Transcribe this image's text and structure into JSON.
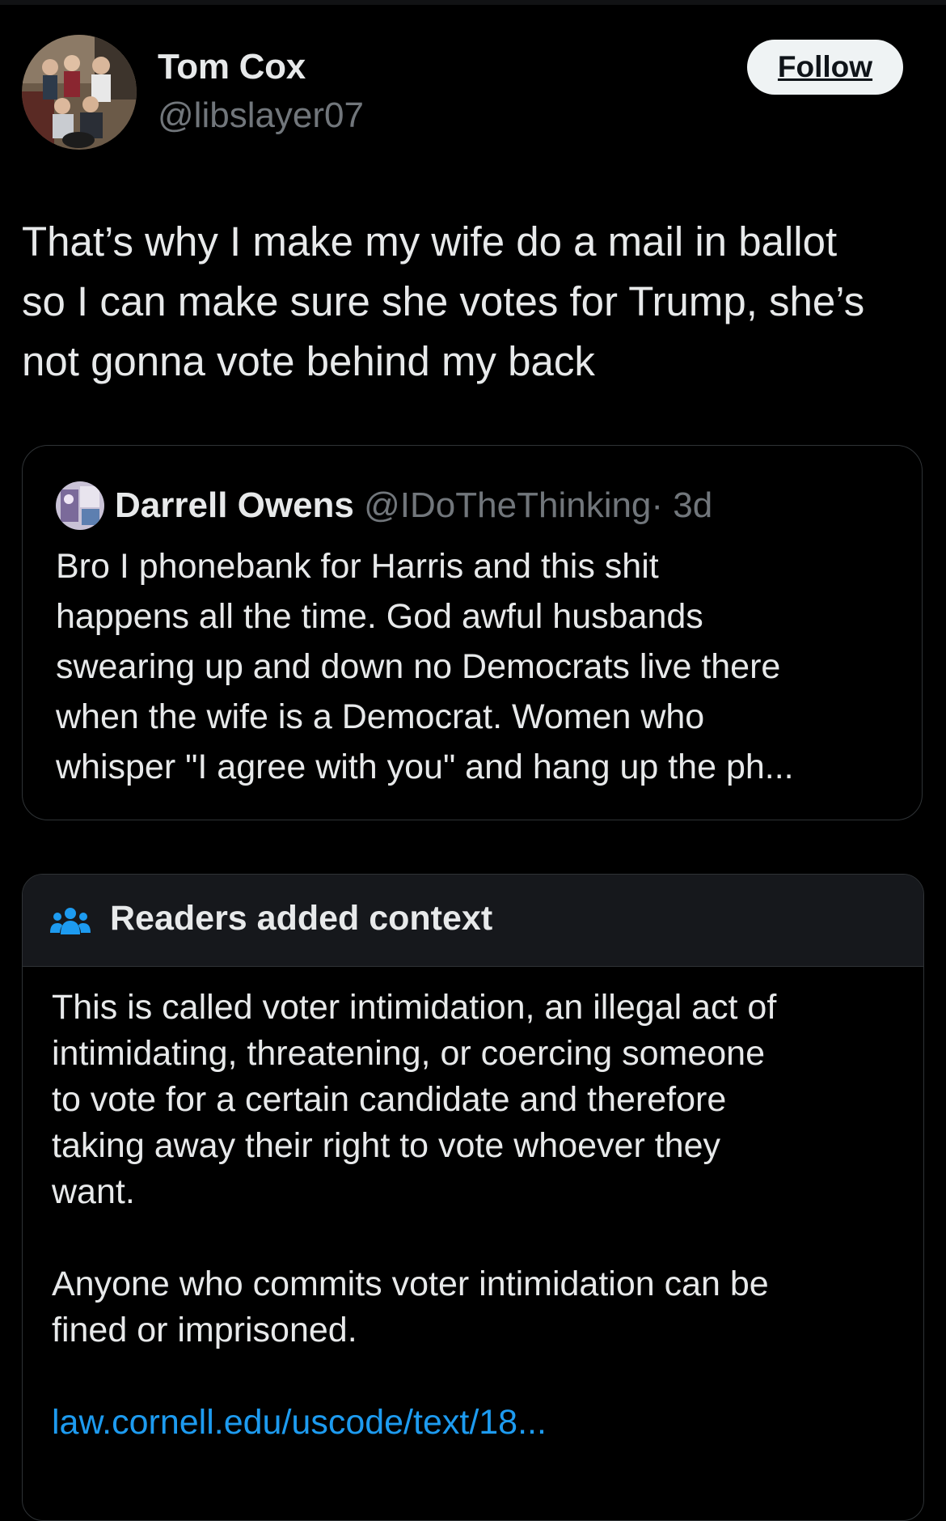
{
  "author": {
    "name": "Tom Cox",
    "handle": "@libslayer07"
  },
  "follow_label": "Follow",
  "tweet": {
    "lines": [
      "That’s why I make my wife do a mail in ballot",
      "so I can make sure she votes for Trump, she’s",
      "not gonna vote behind my back"
    ]
  },
  "quote": {
    "name": "Darrell Owens",
    "handle": "@IDoTheThinking",
    "time": "· 3d",
    "lines": [
      "Bro I phonebank for Harris and this shit",
      "happens all the time. God awful husbands",
      "swearing up and down no Democrats live there",
      "when the wife is a Democrat. Women who",
      "whisper \"I agree with you\" and hang up the ph..."
    ]
  },
  "note": {
    "title": "Readers added context",
    "paragraph1_lines": [
      "This is called voter intimidation, an illegal act of",
      "intimidating, threatening, or coercing someone",
      "to vote for a certain candidate and therefore",
      "taking away their right to vote whoever they",
      "want."
    ],
    "paragraph2_lines": [
      "Anyone who commits voter intimidation can be",
      "fined or imprisoned."
    ],
    "link": "law.cornell.edu/uscode/text/18..."
  },
  "colors": {
    "background": "#000000",
    "text": "#e7e9ea",
    "secondary": "#71767b",
    "link": "#1d9bf0",
    "border": "#2f3336"
  },
  "icons": [
    "people-icon"
  ]
}
